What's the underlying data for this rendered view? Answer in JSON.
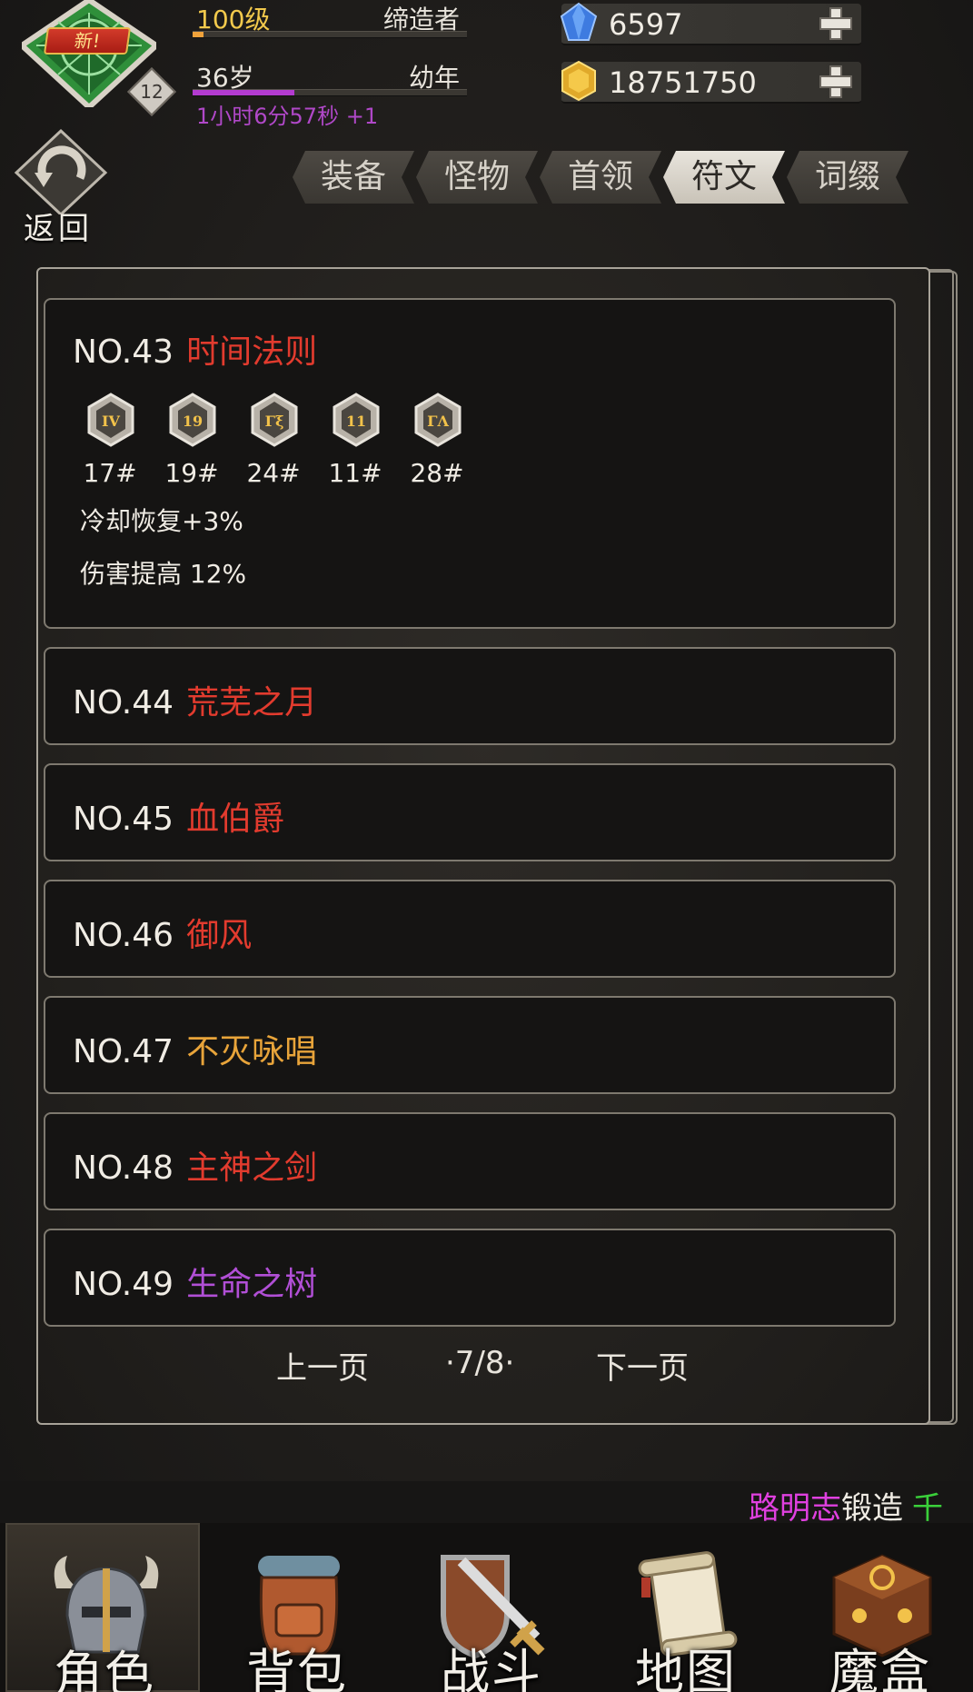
{
  "header": {
    "new_badge": "新!",
    "avatar_level": "12",
    "level_text": "100级",
    "level_progress": 0.04,
    "title_text": "缔造者",
    "age_text": "36岁",
    "stage_text": "幼年",
    "age_progress": 0.37,
    "timer_text": "1小时6分57秒 +1",
    "gems": "6597",
    "gold": "18751750"
  },
  "back_label": "返回",
  "tabs": [
    {
      "label": "装备",
      "active": false
    },
    {
      "label": "怪物",
      "active": false
    },
    {
      "label": "首领",
      "active": false
    },
    {
      "label": "符文",
      "active": true
    },
    {
      "label": "词缀",
      "active": false
    }
  ],
  "runes": {
    "expanded": {
      "no": "NO.43",
      "name": "时间法则",
      "name_color": "#e23b2e",
      "slots": [
        {
          "num": "17#",
          "glyph": "IV"
        },
        {
          "num": "19#",
          "glyph": "19"
        },
        {
          "num": "24#",
          "glyph": "Γξ"
        },
        {
          "num": "11#",
          "glyph": "11"
        },
        {
          "num": "28#",
          "glyph": "ΓΛ"
        }
      ],
      "effects": [
        "冷却恢复+3%",
        "伤害提高 12%"
      ]
    },
    "list": [
      {
        "no": "NO.44",
        "name": "荒芜之月",
        "name_color": "#e23b2e"
      },
      {
        "no": "NO.45",
        "name": "血伯爵",
        "name_color": "#e23b2e"
      },
      {
        "no": "NO.46",
        "name": "御风",
        "name_color": "#e23b2e"
      },
      {
        "no": "NO.47",
        "name": "不灭咏唱",
        "name_color": "#e8a43a"
      },
      {
        "no": "NO.48",
        "name": "主神之剑",
        "name_color": "#e23b2e"
      },
      {
        "no": "NO.49",
        "name": "生命之树",
        "name_color": "#b14fd6"
      }
    ]
  },
  "pager": {
    "prev": "上一页",
    "page": "·7/8·",
    "next": "下一页"
  },
  "ticker": {
    "name": "路明志",
    "name_color": "#e040e0",
    "action": "锻造",
    "item": "千",
    "item_color": "#3ad03a"
  },
  "nav": [
    {
      "label": "角色",
      "icon": "helmet-icon",
      "active": true
    },
    {
      "label": "背包",
      "icon": "backpack-icon",
      "active": false
    },
    {
      "label": "战斗",
      "icon": "sword-shield-icon",
      "active": false
    },
    {
      "label": "地图",
      "icon": "scroll-map-icon",
      "active": false
    },
    {
      "label": "魔盒",
      "icon": "magic-box-icon",
      "active": false
    }
  ]
}
